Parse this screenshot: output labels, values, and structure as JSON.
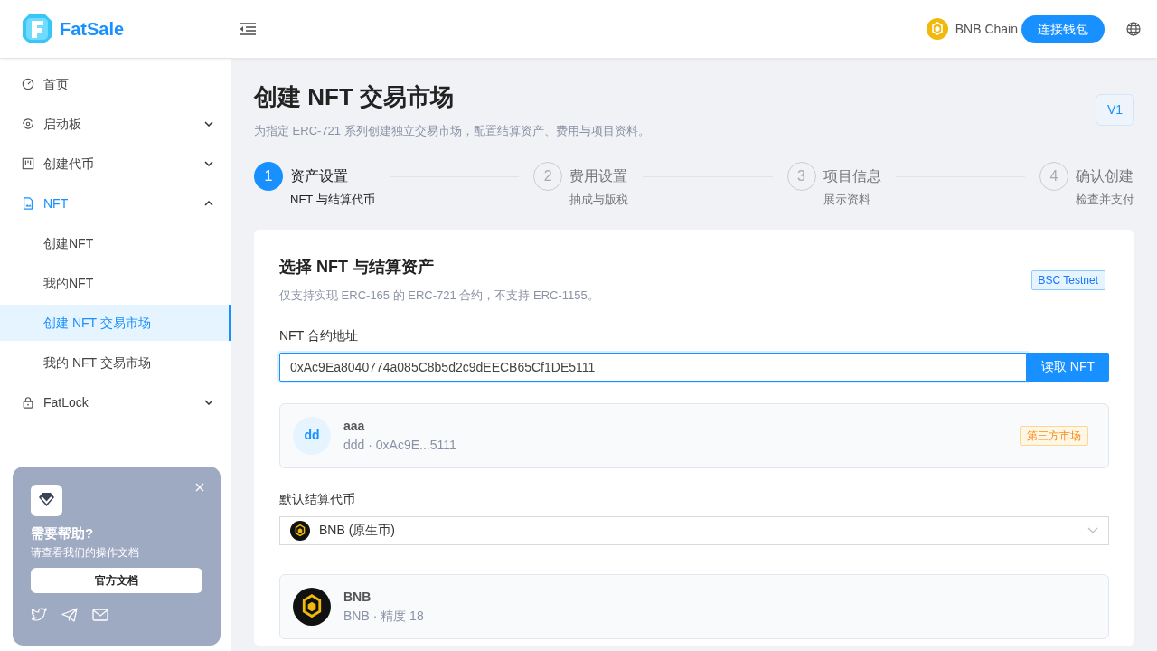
{
  "brand": {
    "name": "FatSale"
  },
  "header": {
    "chain": "BNB Chain",
    "connect_button": "连接钱包"
  },
  "sidebar": {
    "items": [
      {
        "label": "首页",
        "kind": "item",
        "selected": false
      },
      {
        "label": "启动板",
        "kind": "group",
        "expanded": false,
        "selected": false
      },
      {
        "label": "创建代币",
        "kind": "group",
        "expanded": false,
        "selected": false
      },
      {
        "label": "NFT",
        "kind": "group",
        "expanded": true,
        "selected": true,
        "children": [
          {
            "label": "创建NFT",
            "selected": false
          },
          {
            "label": "我的NFT",
            "selected": false
          },
          {
            "label": "创建 NFT 交易市场",
            "selected": true
          },
          {
            "label": "我的 NFT 交易市场",
            "selected": false
          }
        ]
      },
      {
        "label": "FatLock",
        "kind": "group",
        "expanded": false,
        "selected": false
      }
    ]
  },
  "help_card": {
    "title": "需要帮助?",
    "text": "请查看我们的操作文档",
    "button": "官方文档"
  },
  "page": {
    "title": "创建 NFT 交易市场",
    "subtitle": "为指定 ERC-721 系列创建独立交易市场，配置结算资产、费用与项目资料。",
    "version": "V1"
  },
  "steps": [
    {
      "number": "1",
      "title": "资产设置",
      "sub": "NFT 与结算代币",
      "selected": true
    },
    {
      "number": "2",
      "title": "费用设置",
      "sub": "抽成与版税",
      "selected": false
    },
    {
      "number": "3",
      "title": "项目信息",
      "sub": "展示资料",
      "selected": false
    },
    {
      "number": "4",
      "title": "确认创建",
      "sub": "检查并支付",
      "selected": false
    }
  ],
  "card": {
    "title": "选择 NFT 与结算资产",
    "subtitle": "仅支持实现 ERC-165 的 ERC-721 合约，不支持 ERC-1155。",
    "network": "BSC Testnet",
    "contract_label": "NFT 合约地址",
    "contract_value": "0xAc9Ea8040774a085C8b5d2c9dEECB65Cf1DE5111",
    "read_button": "读取 NFT",
    "nft": {
      "avatar": "dd",
      "name": "aaa",
      "detail": "ddd · 0xAc9E...5111",
      "tag": "第三方市场"
    },
    "token_label": "默认结算代币",
    "token_value": "BNB (原生币)",
    "token": {
      "name": "BNB",
      "detail": "BNB · 精度 18"
    }
  }
}
